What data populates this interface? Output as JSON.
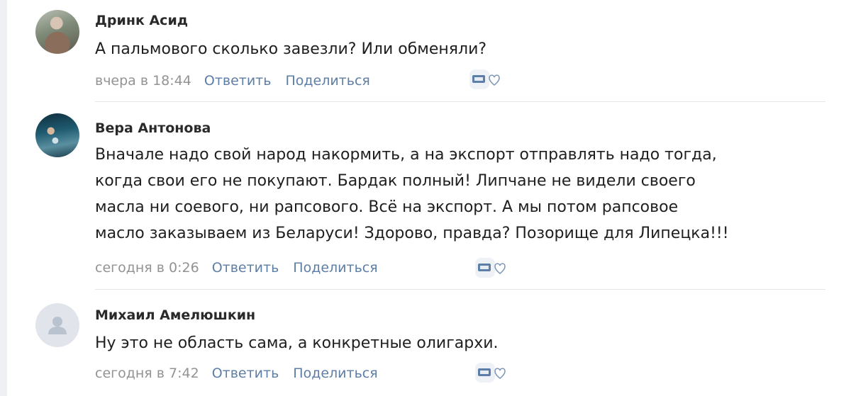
{
  "comments": [
    {
      "author": "Дринк Асид",
      "text_lines": [
        "А пальмового сколько завезли? Или обменяли?"
      ],
      "date": "вчера в 18:44",
      "reply_label": "Ответить",
      "share_label": "Поделиться"
    },
    {
      "author": "Вера Антонова",
      "text_lines": [
        "Вначале надо свой народ накормить, а на экспорт отправлять надо тогда,",
        "когда свои его не покупают. Бардак полный! Липчане не видели своего",
        "масла ни соевого, ни рапсового. Всё на экспорт. А мы потом рапсовое",
        "масло заказываем из Беларуси! Здорово, правда? Позорище для Липецка!!!"
      ],
      "date": "сегодня в 0:26",
      "reply_label": "Ответить",
      "share_label": "Поделиться"
    },
    {
      "author": "Михаил Амелюшкин",
      "text_lines": [
        "Ну это не область сама, а конкретные олигархи."
      ],
      "date": "сегодня в 7:42",
      "reply_label": "Ответить",
      "share_label": "Поделиться"
    }
  ],
  "icons": {
    "reaction": "heart-icon",
    "badge": "reaction-badge-icon",
    "placeholder_avatar": "user-icon"
  },
  "colors": {
    "link": "#5d7ea6",
    "date": "#939393",
    "badge": "#5b7fa8"
  }
}
